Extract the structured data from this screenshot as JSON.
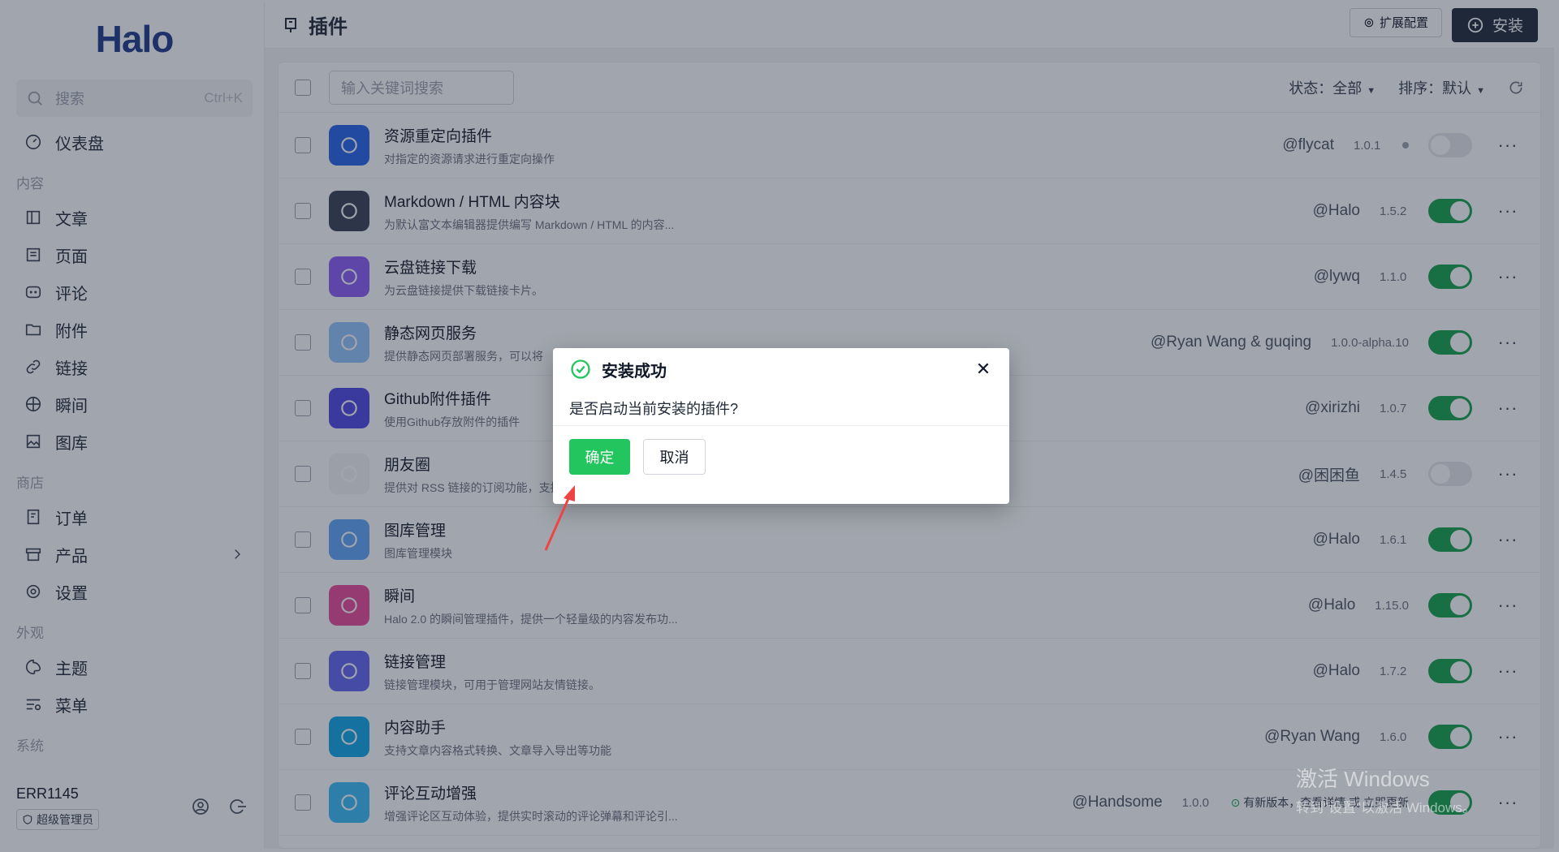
{
  "sidebar": {
    "logo": "Halo",
    "search_label": "搜索",
    "search_shortcut": "Ctrl+K",
    "dashboard": "仪表盘",
    "group_content": "内容",
    "content_items": [
      "文章",
      "页面",
      "评论",
      "附件",
      "链接",
      "瞬间",
      "图库"
    ],
    "group_shop": "商店",
    "shop_items": [
      "订单",
      "产品",
      "设置"
    ],
    "group_appearance": "外观",
    "appearance_items": [
      "主题",
      "菜单"
    ],
    "group_system": "系统",
    "username": "ERR1145",
    "role": "超级管理员"
  },
  "header": {
    "title": "插件",
    "ext_config": "扩展配置",
    "install": "安装"
  },
  "toolbar": {
    "search_placeholder": "输入关键词搜索",
    "status_label": "状态：",
    "status_value": "全部",
    "sort_label": "排序：",
    "sort_value": "默认"
  },
  "plugins": [
    {
      "name": "资源重定向插件",
      "desc": "对指定的资源请求进行重定向操作",
      "author": "@flycat",
      "version": "1.0.1",
      "enabled": false,
      "logo_color": "#2563eb"
    },
    {
      "name": "Markdown / HTML 内容块",
      "desc": "为默认富文本编辑器提供编写 Markdown / HTML 的内容...",
      "author": "@Halo",
      "version": "1.5.2",
      "enabled": true,
      "logo_color": "#374151"
    },
    {
      "name": "云盘链接下载",
      "desc": "为云盘链接提供下载链接卡片。",
      "author": "@lywq",
      "version": "1.1.0",
      "enabled": true,
      "logo_color": "#8b5cf6"
    },
    {
      "name": "静态网页服务",
      "desc": "提供静态网页部署服务，可以将",
      "author": "@Ryan Wang & guqing",
      "version": "1.0.0-alpha.10",
      "enabled": true,
      "logo_color": "#93c5fd"
    },
    {
      "name": "Github附件插件",
      "desc": "使用Github存放附件的插件",
      "author": "@xirizhi",
      "version": "1.0.7",
      "enabled": true,
      "logo_color": "#4f46e5"
    },
    {
      "name": "朋友圈",
      "desc": "提供对 RSS 链接的订阅功能，支持获取其订阅内容",
      "author": "@困困鱼",
      "version": "1.4.5",
      "enabled": false,
      "logo_color": "#f3f4f6"
    },
    {
      "name": "图库管理",
      "desc": "图库管理模块",
      "author": "@Halo",
      "version": "1.6.1",
      "enabled": true,
      "logo_color": "#60a5fa"
    },
    {
      "name": "瞬间",
      "desc": "Halo 2.0 的瞬间管理插件，提供一个轻量级的内容发布功...",
      "author": "@Halo",
      "version": "1.15.0",
      "enabled": true,
      "logo_color": "#ec4899"
    },
    {
      "name": "链接管理",
      "desc": "链接管理模块，可用于管理网站友情链接。",
      "author": "@Halo",
      "version": "1.7.2",
      "enabled": true,
      "logo_color": "#6366f1"
    },
    {
      "name": "内容助手",
      "desc": "支持文章内容格式转换、文章导入导出等功能",
      "author": "@Ryan Wang",
      "version": "1.6.0",
      "enabled": true,
      "logo_color": "#0ea5e9"
    },
    {
      "name": "评论互动增强",
      "desc": "增强评论区互动体验，提供实时滚动的评论弹幕和评论引...",
      "author": "@Handsome",
      "version": "1.0.0",
      "enabled": true,
      "logo_color": "#38bdf8",
      "update_text": "有新版本，",
      "update_link1": "查看详情",
      "update_or": " 或 ",
      "update_link2": "立即更新"
    }
  ],
  "modal": {
    "title": "安装成功",
    "message": "是否启动当前安装的插件?",
    "confirm": "确定",
    "cancel": "取消",
    "close": "✕"
  },
  "watermark": {
    "line1": "激活 Windows",
    "line2": "转到\"设置\"以激活 Windows。"
  }
}
